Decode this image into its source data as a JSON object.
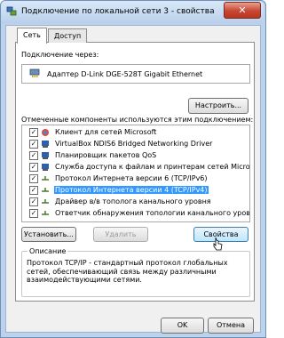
{
  "window": {
    "title": "Подключение по локальной сети 3 - свойства",
    "close_glyph": "✕"
  },
  "tabs": [
    {
      "label": "Сеть",
      "selected": true
    },
    {
      "label": "Доступ",
      "selected": false
    }
  ],
  "connect_via_label": "Подключение через:",
  "adapter": {
    "name": "Адаптер D-Link DGE-528T Gigabit Ethernet",
    "icon": "network-adapter-icon"
  },
  "configure_label": "Настроить...",
  "components_label": "Отмеченные компоненты используются этим подключением:",
  "components": [
    {
      "label": "Клиент для сетей Microsoft",
      "checked": true,
      "icon": "network-client-icon"
    },
    {
      "label": "VirtualBox NDIS6 Bridged Networking Driver",
      "checked": true,
      "icon": "network-driver-icon"
    },
    {
      "label": "Планировщик пакетов QoS",
      "checked": true,
      "icon": "network-service-icon"
    },
    {
      "label": "Служба доступа к файлам и принтерам сетей Micro...",
      "checked": true,
      "icon": "network-service-icon"
    },
    {
      "label": "Протокол Интернета версии 6 (TCP/IPv6)",
      "checked": true,
      "icon": "protocol-icon"
    },
    {
      "label": "Протокол Интернета версии 4 (TCP/IPv4)",
      "checked": true,
      "icon": "protocol-icon",
      "selected": true
    },
    {
      "label": "Драйвер в/в тополога канального уровня",
      "checked": true,
      "icon": "protocol-icon"
    },
    {
      "label": "Ответчик обнаружения топологии канального уровня",
      "checked": true,
      "icon": "protocol-icon"
    }
  ],
  "buttons": {
    "install": "Установить...",
    "remove": "Удалить",
    "properties": "Свойства",
    "ok": "OK",
    "cancel": "Отмена"
  },
  "description": {
    "legend": "Описание",
    "text": "Протокол TCP/IP - стандартный протокол глобальных сетей, обеспечивающий связь между различными взаимодействующими сетями."
  },
  "colors": {
    "selection": "#3399ff",
    "close_button": "#c74632"
  }
}
